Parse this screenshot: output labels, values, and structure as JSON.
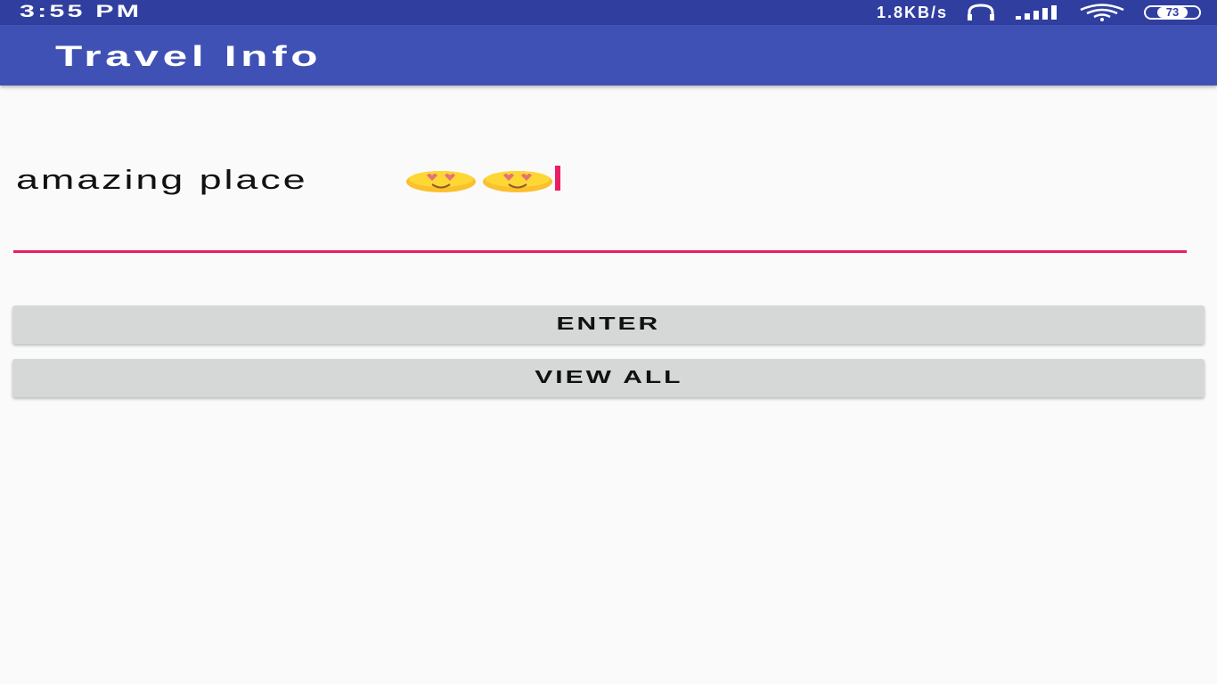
{
  "status_bar": {
    "time": "3:55 PM",
    "net_speed": "1.8KB/s",
    "battery": "73",
    "icons": [
      "headset-icon",
      "signal-icon",
      "wifi-icon",
      "battery-icon"
    ]
  },
  "app_bar": {
    "title": "Travel Info"
  },
  "input": {
    "value": "amazing place",
    "emojis": [
      "smiling-face-with-heart-eyes-icon",
      "smiling-face-with-heart-eyes-icon"
    ],
    "accent_color": "#e91e63"
  },
  "buttons": {
    "enter_label": "ENTER",
    "view_all_label": "VIEW ALL"
  },
  "colors": {
    "status_bar": "#303f9f",
    "app_bar": "#3f51b5",
    "background": "#fafafa",
    "button": "#d6d7d7"
  }
}
